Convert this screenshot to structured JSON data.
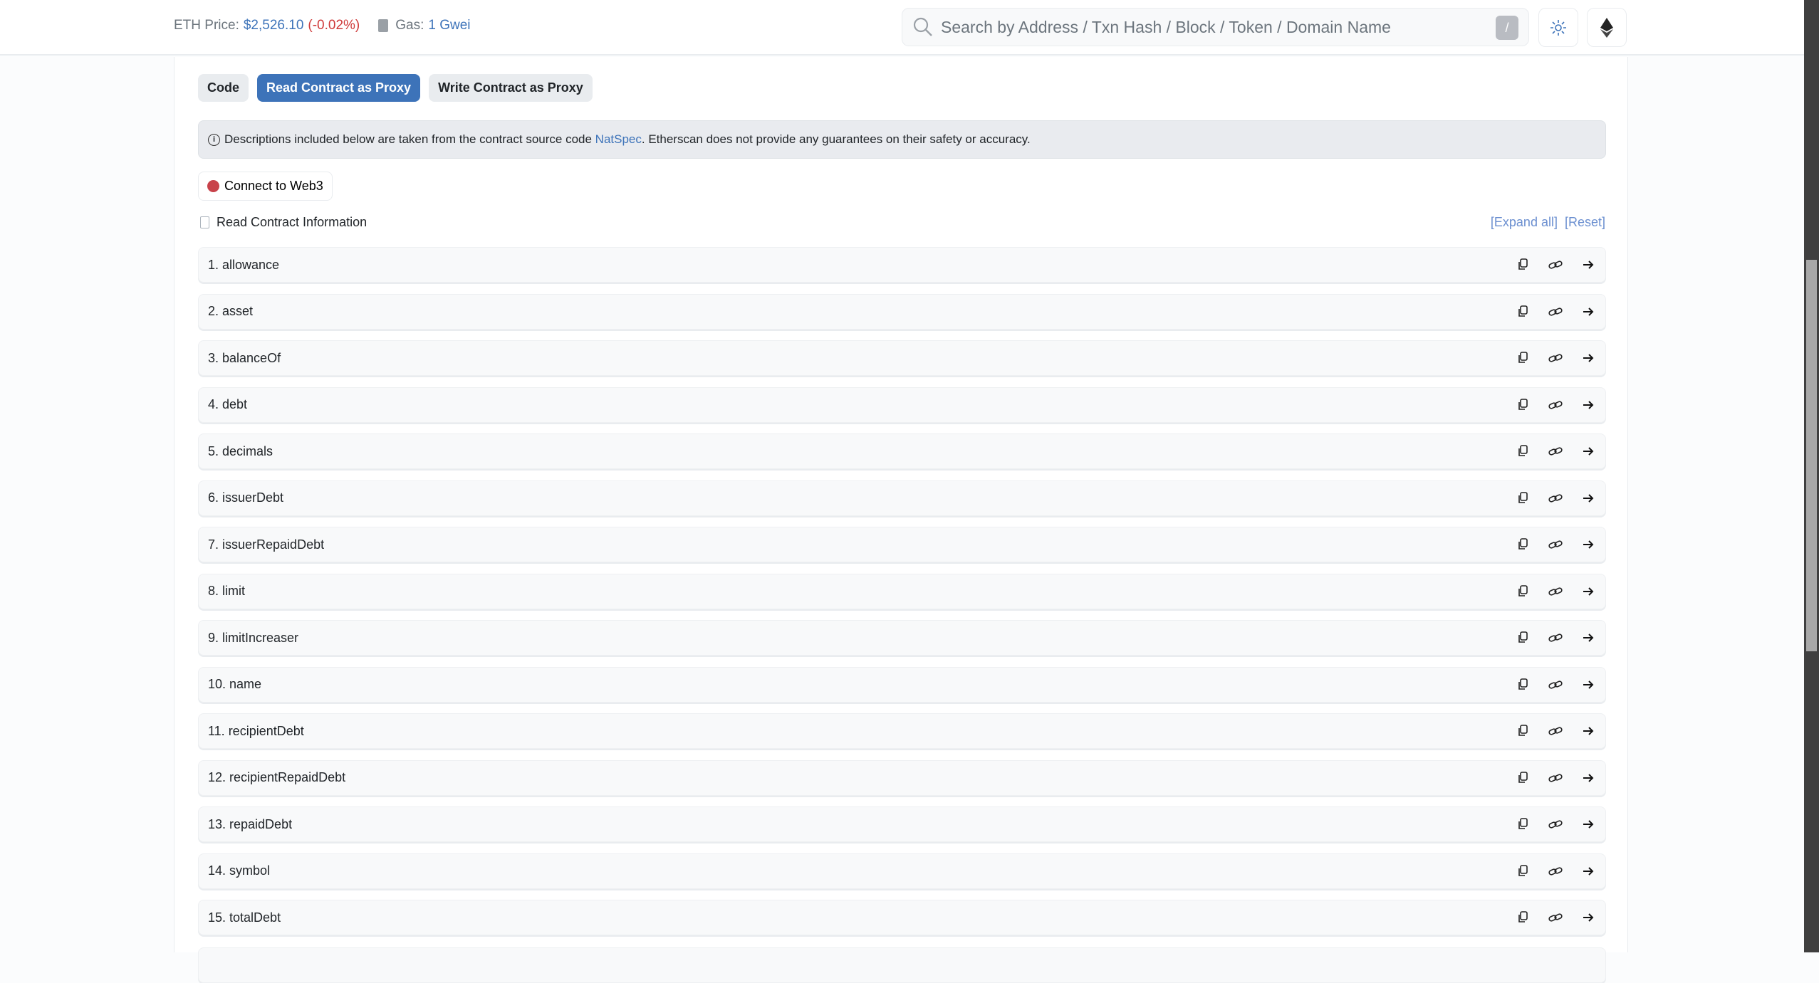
{
  "header": {
    "eth_price_label": "ETH Price:",
    "eth_price": "$2,526.10",
    "eth_change": "(-0.02%)",
    "gas_label": "Gas:",
    "gas_value": "1 Gwei",
    "search_placeholder": "Search by Address / Txn Hash / Block / Token / Domain Name",
    "search_shortcut": "/"
  },
  "tabs": [
    {
      "label": "Code"
    },
    {
      "label": "Read Contract as Proxy",
      "active": true
    },
    {
      "label": "Write Contract as Proxy"
    }
  ],
  "notice": {
    "before": "Descriptions included below are taken from the contract source code ",
    "link": "NatSpec",
    "after": ". Etherscan does not provide any guarantees on their safety or accuracy."
  },
  "connect_label": "Connect to Web3",
  "section_title": "Read Contract Information",
  "expand_all": "[Expand all]",
  "reset": "[Reset]",
  "functions": [
    "1. allowance",
    "2. asset",
    "3. balanceOf",
    "4. debt",
    "5. decimals",
    "6. issuerDebt",
    "7. issuerRepaidDebt",
    "8. limit",
    "9. limitIncreaser",
    "10. name",
    "11. recipientDebt",
    "12. recipientRepaidDebt",
    "13. repaidDebt",
    "14. symbol",
    "15. totalDebt"
  ],
  "colors": {
    "accent": "#3d73b9",
    "negative": "#cf3a3a",
    "connect_status": "#c8424a"
  }
}
